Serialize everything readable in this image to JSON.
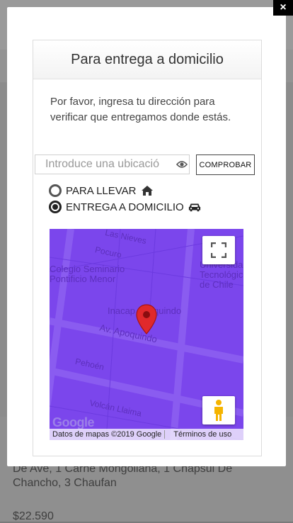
{
  "background": {
    "description_line1": "De Ave, 1 Carne Mongoliana, 1 Chapsui De",
    "description_line2": "Chancho, 3 Chaufan",
    "price": "$22.590"
  },
  "modal": {
    "close_label": "×",
    "title": "Para entrega a domicilio",
    "intro": "Por favor, ingresa tu dirección para verificar que entregamos donde estás.",
    "address": {
      "placeholder": "Introduce una ubicació",
      "value": ""
    },
    "check_button": "COMPROBAR",
    "options": [
      {
        "label": "PARA LLEVAR",
        "selected": false,
        "icon": "home-icon"
      },
      {
        "label": "ENTREGA A DOMICILIO",
        "selected": true,
        "icon": "car-icon"
      }
    ]
  },
  "map": {
    "labels": {
      "street1": "Pocuro",
      "poi1_line1": "Colegio Seminario",
      "poi1_line2": "Pontificio Menor",
      "poi2_line1": "Universidad",
      "poi2_line2": "Tecnológica",
      "poi2_line3": "de Chile",
      "street2": "Inacap Apoquindo",
      "street3": "Av. Apoquindo",
      "street4": "Pehoén",
      "street5": "Volcán Llaima",
      "street6": "Las Nieves"
    },
    "attribution": "Datos de mapas ©2019 Google",
    "terms": "Términos de uso",
    "logo": "Google",
    "colors": {
      "map_bg": "#7b46ec",
      "pin": "#e0292b"
    }
  }
}
